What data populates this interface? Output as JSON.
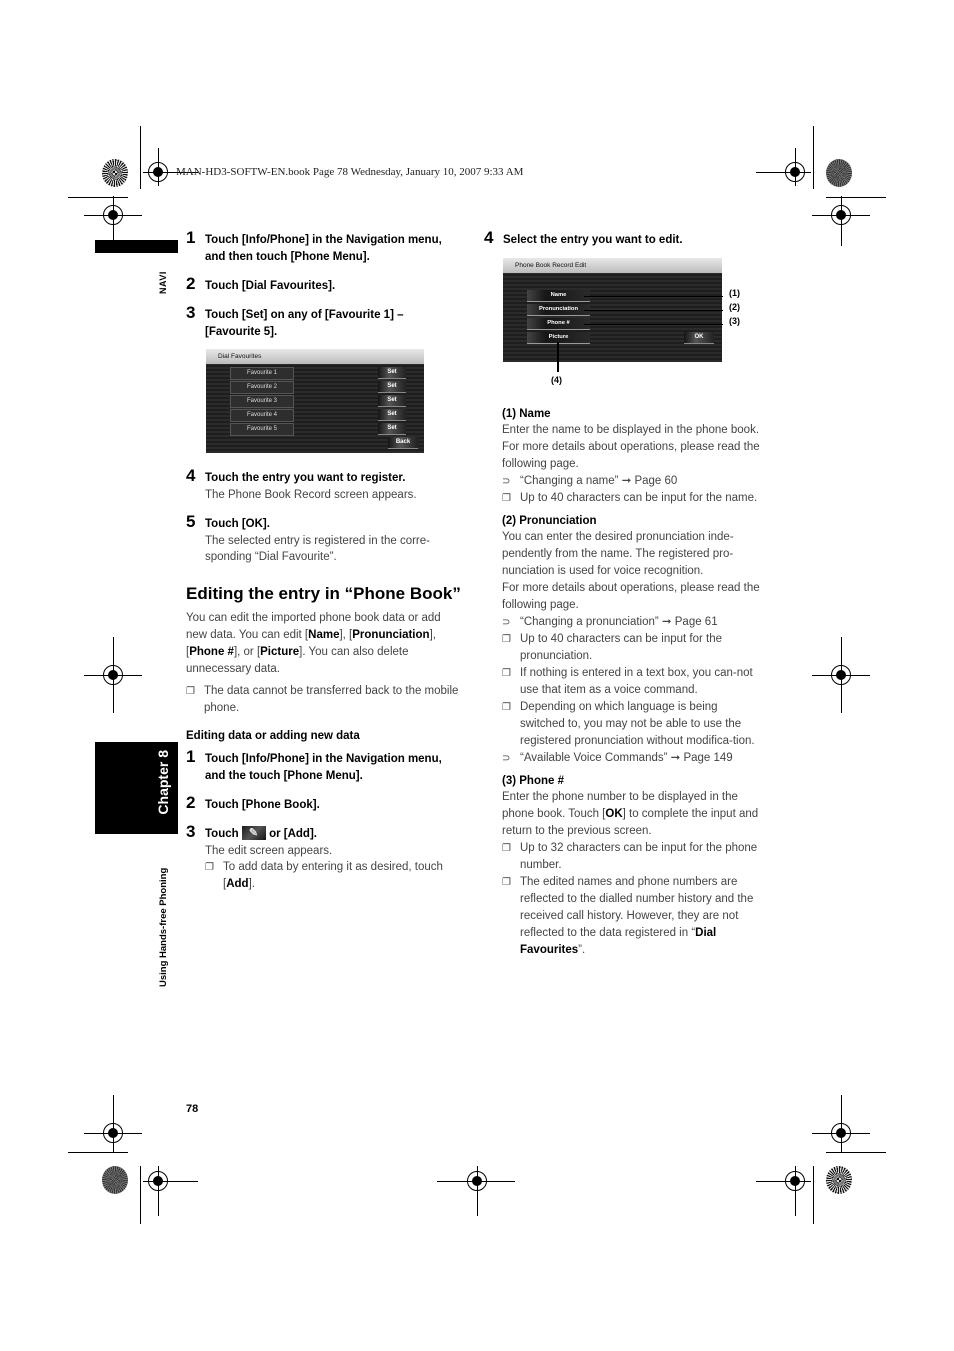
{
  "header": {
    "print_line": "MAN-HD3-SOFTW-EN.book  Page 78  Wednesday, January 10, 2007  9:33 AM"
  },
  "side": {
    "tab": "NAVI",
    "chapter": "Chapter 8",
    "section": "Using Hands-free Phoning"
  },
  "left": {
    "steps_a": [
      {
        "num": "1",
        "text": "Touch [Info/Phone] in the Navigation menu, and then touch [Phone Menu]."
      },
      {
        "num": "2",
        "text": "Touch [Dial Favourites]."
      },
      {
        "num": "3",
        "text": "Touch [Set] on any of [Favourite 1] – [Favourite 5]."
      }
    ],
    "dial_screen": {
      "title": "Dial Favourites",
      "favourites": [
        "Favourite 1",
        "Favourite 2",
        "Favourite 3",
        "Favourite 4",
        "Favourite 5"
      ],
      "set_label": "Set",
      "back_label": "Back"
    },
    "steps_b": [
      {
        "num": "4",
        "text": "Touch the entry you want to register.",
        "desc": "The Phone Book Record screen appears."
      },
      {
        "num": "5",
        "text": "Touch [OK].",
        "desc": "The selected entry is registered in the corre-sponding “Dial Favourite”."
      }
    ],
    "section_title": "Editing the entry in “Phone Book”",
    "intro": {
      "p1": "You can edit the imported phone book data or add new data. You can edit [",
      "b_name": "Name",
      "p2": "], [",
      "b_pron": "Pronunciation",
      "p3": "], [",
      "b_phone": "Phone #",
      "p4": "], or [",
      "b_pic": "Picture",
      "p5": "]. You can also delete unnecessary data."
    },
    "note1": "The data cannot be transferred back to the mobile phone.",
    "sub_title": "Editing data or adding new data",
    "steps_c": [
      {
        "num": "1",
        "text": "Touch [Info/Phone] in the Navigation menu, and the touch [Phone Menu]."
      },
      {
        "num": "2",
        "text": "Touch [Phone Book]."
      }
    ],
    "step3": {
      "num": "3",
      "pre": "Touch",
      "post": "or [Add].",
      "desc": "The edit screen appears.",
      "note_pre": "To add data by entering it as desired, touch [",
      "note_bold": "Add",
      "note_post": "]."
    },
    "page_number": "78"
  },
  "right": {
    "step4": {
      "num": "4",
      "text": "Select the entry you want to edit."
    },
    "edit_screen": {
      "title": "Phone Book Record Edit",
      "buttons": [
        "Name",
        "Pronunciation",
        "Phone #",
        "Picture"
      ],
      "ok_label": "OK",
      "callouts": [
        "(1)",
        "(2)",
        "(3)",
        "(4)"
      ]
    },
    "name": {
      "heading": "(1) Name",
      "p1": "Enter the name to be displayed in the phone book.",
      "p2": "For more details about operations, please read the following page.",
      "ref": "“Changing a name” ➞ Page 60",
      "note": "Up to 40 characters can be input for the name."
    },
    "pron": {
      "heading": "(2) Pronunciation",
      "p1": "You can enter the desired pronunciation inde-pendently from the name. The registered pro-nunciation is used for voice recognition.",
      "p2": "For more details about operations, please read the following page.",
      "ref": "“Changing a pronunciation” ➞ Page 61",
      "notes": [
        "Up to 40 characters can be input for the pronunciation.",
        "If nothing is entered in a text box, you can-not use that item as a voice command.",
        "Depending on which language is being switched to, you may not be able to use the registered pronunciation without modifica-tion."
      ],
      "ref2": "“Available Voice Commands” ➞ Page 149"
    },
    "phone": {
      "heading": "(3) Phone #",
      "p1_pre": "Enter the phone number to be displayed in the phone book. Touch [",
      "p1_bold": "OK",
      "p1_post": "] to complete the input and return to the previous screen.",
      "note1": "Up to 32 characters can be input for the phone number.",
      "note2_pre": "The edited names and phone numbers are reflected to the dialled number history and the received call history. However, they are not reflected to the data registered in “",
      "note2_bold": "Dial Favourites",
      "note2_post": "”."
    }
  },
  "glyphs": {
    "note_box": "❐",
    "ref_arrow": "⊃"
  }
}
